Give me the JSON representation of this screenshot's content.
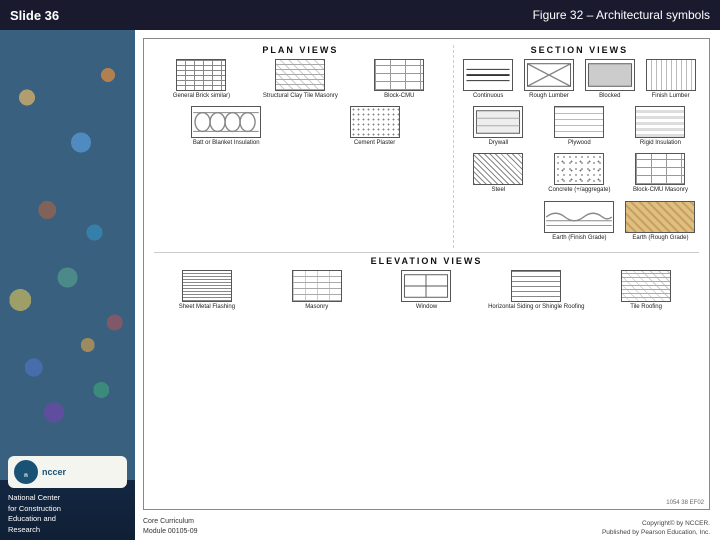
{
  "header": {
    "slide_label": "Slide 36",
    "figure_title": "Figure 32 – Architectural symbols"
  },
  "sidebar": {
    "nccer_logo_text": "nccer",
    "org_name": "National Center",
    "org_line2": "for Construction",
    "org_line3": "Education and",
    "org_line4": "Research"
  },
  "footer": {
    "curriculum_label": "Core Curriculum",
    "module_label": "Module 00105-09",
    "copyright_line1": "Copyright© by NCCER.",
    "copyright_line2": "Published by Pearson Education, Inc."
  },
  "figure": {
    "plan_views_title": "PLAN VIEWS",
    "section_views_title": "SECTION VIEWS",
    "elevation_views_title": "ELEVATION VIEWS",
    "symbols": {
      "general_brick": "General Brick similar)",
      "structural_clay": "Structural Clay Tile Masonry",
      "block_cmu_plan": "Block-CMU",
      "batt_insulation": "Batt or Blanket Insulation",
      "cement_plaster": "Cement Plaster",
      "continuous": "Continuous",
      "rough_lumber": "Rough Lumber",
      "blocked": "Blocked",
      "finish_lumber": "Finish Lumber",
      "drywall": "Drywall",
      "plywood": "Plywood",
      "rigid_insulation": "Rigid Insulation",
      "steel": "Steel",
      "concrete": "Concrete (+/aggregate)",
      "block_cmu_section": "Block-CMU Masonry",
      "earth_finish": "Earth (Finish Grade)",
      "earth_rough": "Earth (Rough Grade)",
      "sheet_metal": "Sheet Metal Flashing",
      "masonry_elev": "Masonry",
      "window": "Window",
      "horiz_siding": "Horizontal Siding or Shingle Roofing",
      "tile_roofing": "Tile Roofing"
    },
    "figure_number": "1054 38 EF02"
  }
}
